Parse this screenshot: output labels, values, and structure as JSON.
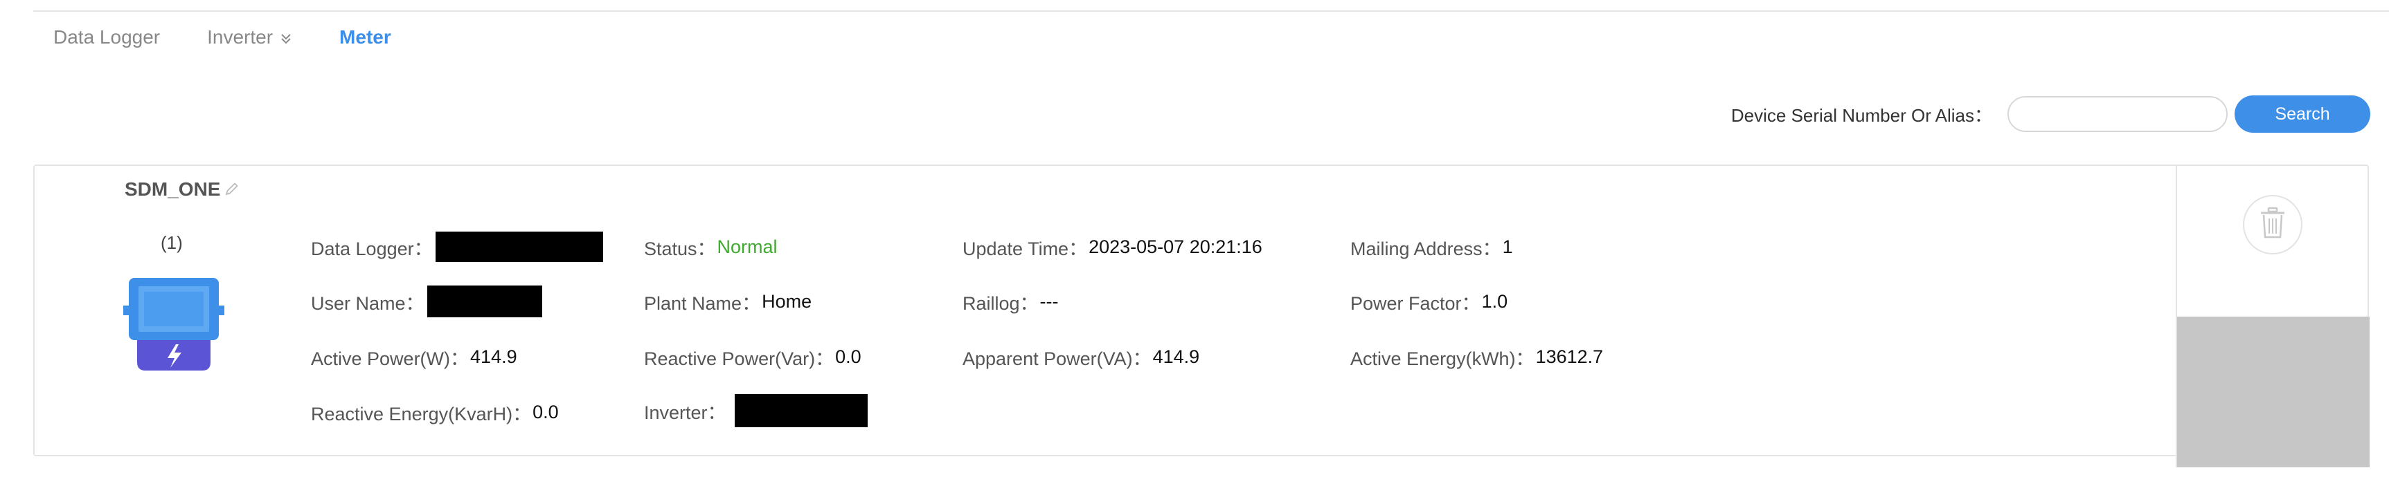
{
  "tabs": [
    {
      "label": "Data Logger",
      "active": false
    },
    {
      "label": "Inverter",
      "active": false,
      "icon": "double-chevron-down-icon"
    },
    {
      "label": "Meter",
      "active": true
    }
  ],
  "search": {
    "label": "Device Serial Number Or Alias：",
    "placeholder": "",
    "value": "",
    "button_label": "Search"
  },
  "device": {
    "name": "SDM_ONE",
    "index": "(1)",
    "icon": "meter-device-icon",
    "fields": {
      "data_logger": {
        "label": "Data Logger：",
        "value": ""
      },
      "status": {
        "label": "Status：",
        "value": "Normal"
      },
      "update_time": {
        "label": "Update Time：",
        "value": "2023-05-07 20:21:16"
      },
      "mailing_address": {
        "label": "Mailing Address：",
        "value": "1"
      },
      "user_name": {
        "label": "User Name：",
        "value": ""
      },
      "plant_name": {
        "label": "Plant Name：",
        "value": "Home"
      },
      "raillog": {
        "label": "Raillog：",
        "value": "---"
      },
      "power_factor": {
        "label": "Power Factor：",
        "value": "1.0"
      },
      "active_power": {
        "label": "Active Power(W)：",
        "value": "414.9"
      },
      "reactive_power": {
        "label": "Reactive Power(Var)：",
        "value": "0.0"
      },
      "apparent_power": {
        "label": "Apparent Power(VA)：",
        "value": "414.9"
      },
      "active_energy": {
        "label": "Active Energy(kWh)：",
        "value": "13612.7"
      },
      "reactive_energy": {
        "label": "Reactive Energy(KvarH)：",
        "value": "0.0"
      },
      "inverter": {
        "label": "Inverter：",
        "value": ""
      }
    }
  },
  "colors": {
    "accent": "#3d8fe8",
    "status_normal": "#3faa2f",
    "meter_icon_blue": "#3d8fe8",
    "meter_icon_purple": "#5b55d6"
  }
}
